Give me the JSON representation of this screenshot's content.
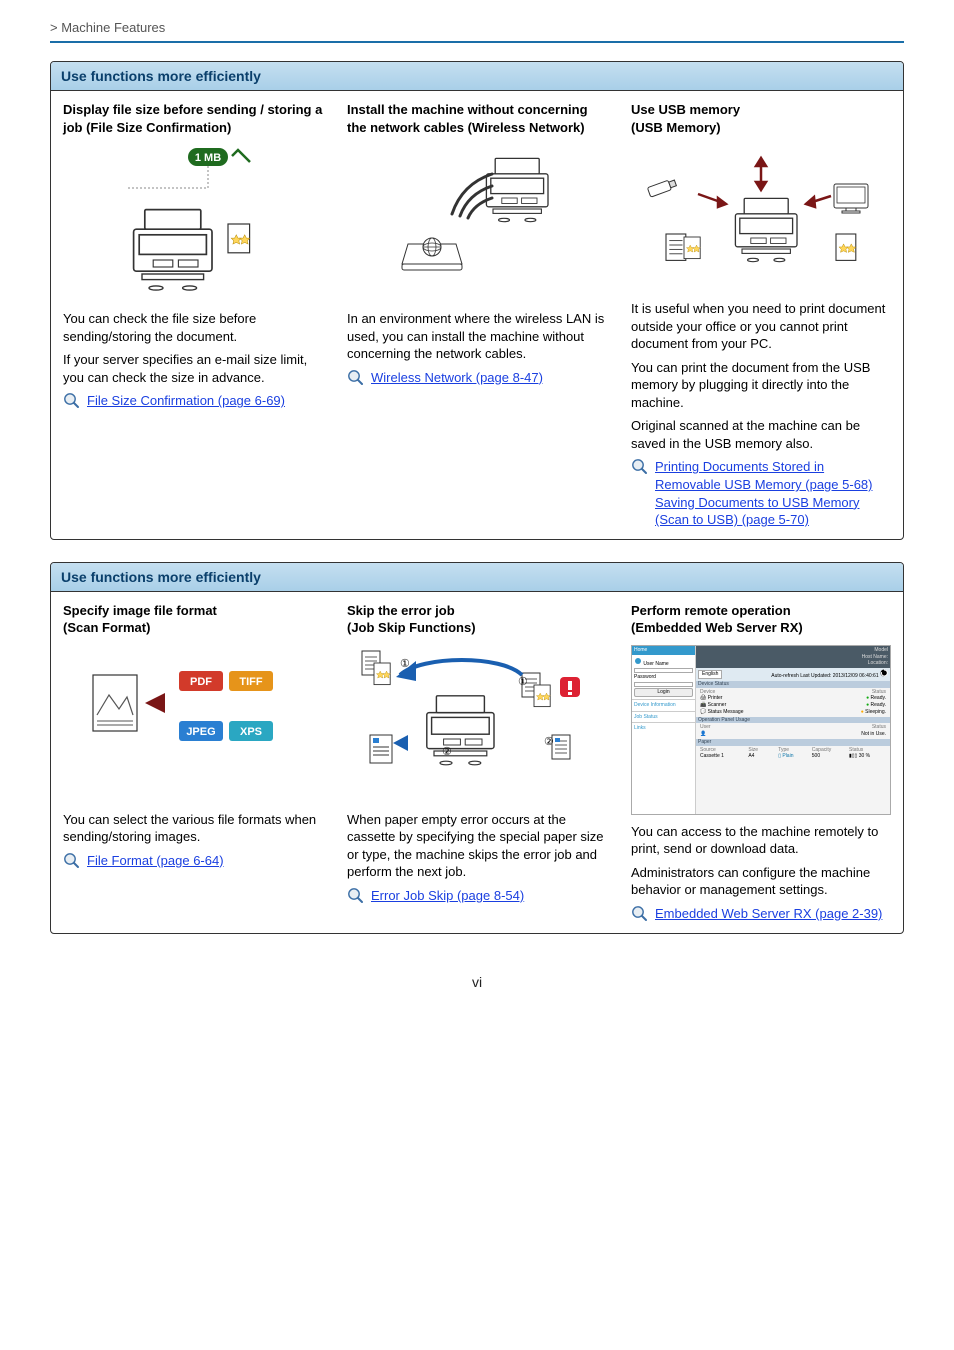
{
  "breadcrumb": "> Machine Features",
  "box1": {
    "header": "Use functions more efficiently",
    "col1": {
      "title": "Display file size before sending / storing a job (File Size Confirmation)",
      "badge": "1 MB",
      "p1": "You can check the file size before sending/storing the document.",
      "p2": "If your server specifies an e-mail size limit, you can check the size in advance.",
      "link": "File Size Confirmation (page 6-69)"
    },
    "col2": {
      "title": "Install the machine without concerning the network cables (Wireless Network)",
      "p1": "In an environment where the wireless LAN is used, you can install the machine without concerning the network cables.",
      "link": "Wireless Network (page 8-47)"
    },
    "col3": {
      "title": "Use USB memory\n(USB Memory)",
      "p1": "It is useful when you need to print document outside your office or you cannot print document from your PC.",
      "p2": "You can print the document from the USB memory by plugging it directly into the machine.",
      "p3": "Original scanned at the machine can be saved in the USB memory also.",
      "link1": "Printing Documents Stored in Removable USB Memory (page 5-68)",
      "link2": "Saving Documents to USB Memory (Scan to USB) (page 5-70)"
    }
  },
  "box2": {
    "header": "Use functions more efficiently",
    "col1": {
      "title": "Specify image file format\n(Scan Format)",
      "badge_pdf": "PDF",
      "badge_tiff": "TIFF",
      "badge_jpeg": "JPEG",
      "badge_xps": "XPS",
      "p1": "You can select the various file formats when sending/storing images.",
      "link": "File Format (page 6-64)"
    },
    "col2": {
      "title": "Skip the error job\n(Job Skip Functions)",
      "p1": "When paper empty error occurs at the cassette by specifying the special paper size or type, the machine skips the error job and perform the next job.",
      "link": "Error Job Skip (page 8-54)"
    },
    "col3": {
      "title": "Perform remote operation\n(Embedded Web Server RX)",
      "ui": {
        "title_model": "Model",
        "hostname": "Host Name:",
        "location": "Location:",
        "home": "Home",
        "lang": "English",
        "autorefresh": "Auto-refresh",
        "lastupdated": "Last Updated:",
        "timestamp": "2013/12/09 06:40:61",
        "username_lbl": "User Name",
        "password_lbl": "Password",
        "login_btn": "Login",
        "device_info": "Device Information",
        "job_status": "Job Status",
        "links": "Links",
        "dev_status_hdr": "Device Status",
        "dev_device": "Device",
        "dev_status_col": "Status",
        "dev_printer": "Printer",
        "dev_ready": "Ready.",
        "dev_scanner": "Scanner",
        "dev_statusmsg": "Status Message",
        "dev_sleeping": "Sleeping.",
        "op_panel_hdr": "Operation Panel Usage",
        "op_user": "User",
        "op_status": "Status",
        "op_notinuse": "Not in Use.",
        "paper_hdr": "Paper",
        "paper_source": "Source",
        "paper_size": "Size",
        "paper_type": "Type",
        "paper_capacity": "Capacity",
        "paper_status": "Status",
        "paper_cassette": "Cassette 1",
        "paper_a4": "A4",
        "paper_plain": "Plain",
        "paper_cap": "500",
        "paper_pct": "30 %"
      },
      "p1": "You can access to the machine remotely to print, send or download data.",
      "p2": "Administrators can configure the machine behavior or management settings.",
      "link": "Embedded Web Server RX (page 2-39)"
    }
  },
  "page_number": "vi"
}
